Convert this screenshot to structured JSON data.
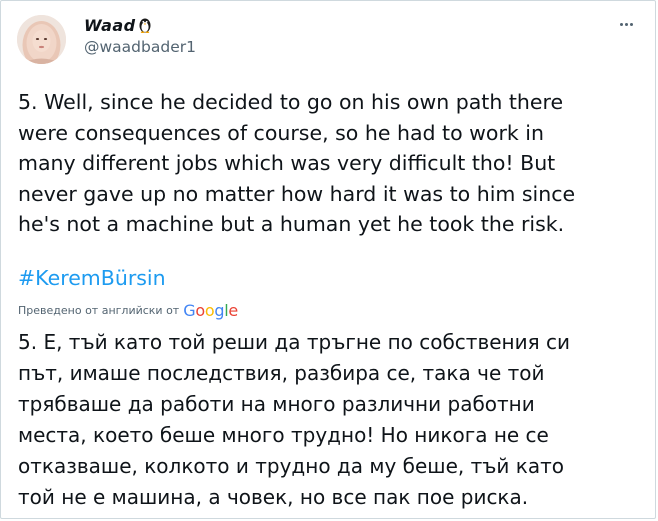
{
  "author": {
    "display_name": "Waad",
    "emoji_icon": "penguin-icon",
    "handle": "@waadbader1"
  },
  "tweet": {
    "lines": [
      "5. Well, since he decided to go on his own path there",
      "were consequences of course, so he had to work in",
      "many different jobs which was very difficult tho! But",
      "never gave up no matter how hard it was to him since",
      "he's not a machine but a human yet he took the risk."
    ],
    "hashtag": "#KeremBürsin"
  },
  "translation": {
    "label": "Преведено от английски от",
    "provider_letters": [
      "G",
      "o",
      "o",
      "g",
      "l",
      "e"
    ],
    "provider_colors": [
      "#4285f4",
      "#ea4335",
      "#fbbc05",
      "#4285f4",
      "#34a853",
      "#ea4335"
    ],
    "lines": [
      "5. Е, тъй като той реши да тръгне по собствения си",
      "път, имаше последствия, разбира се, така че той",
      "трябваше да работи на много различни работни",
      "места, което беше много трудно! Но никога не се",
      "отказваше, колкото и трудно да му беше, тъй като",
      "той не е машина, а човек, но все пак пое риска."
    ]
  },
  "colors": {
    "link": "#1d9bf0",
    "secondary_text": "#536471",
    "primary_text": "#0f1419"
  }
}
